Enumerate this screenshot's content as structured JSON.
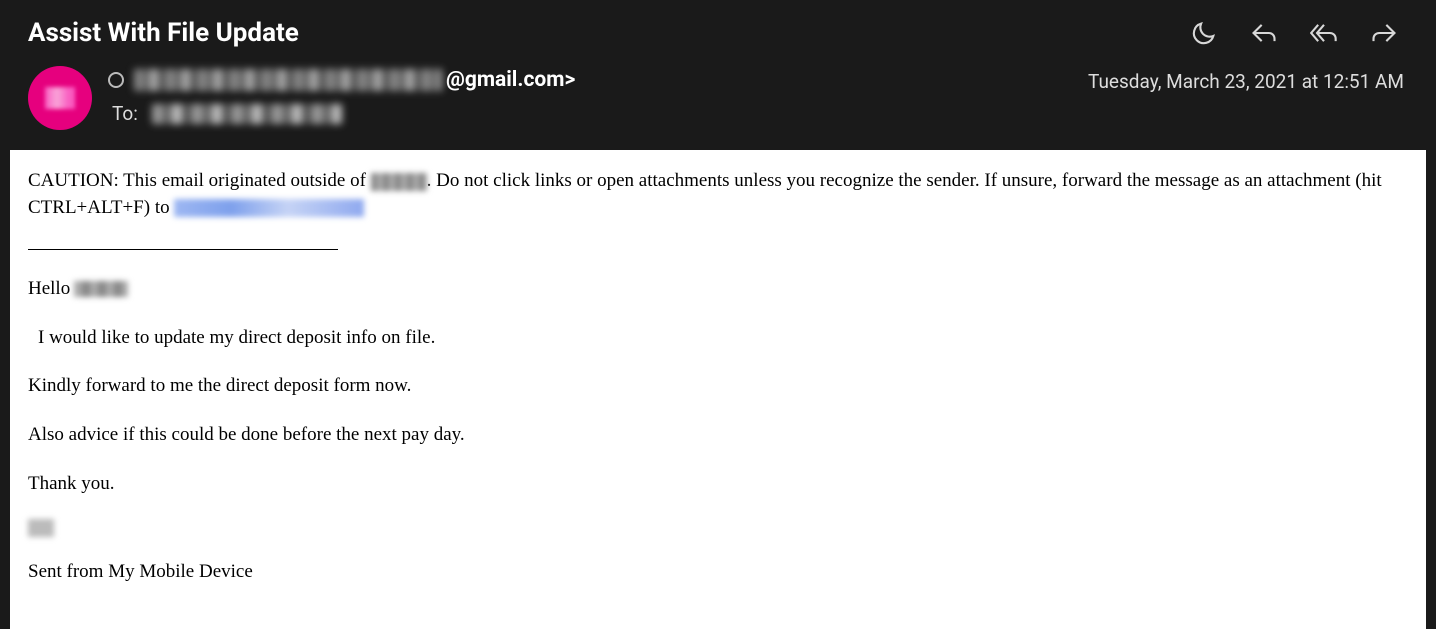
{
  "header": {
    "subject": "Assist With File Update",
    "sender_suffix": "@gmail.com>",
    "to_label": "To:",
    "timestamp": "Tuesday, March 23, 2021 at 12:51 AM"
  },
  "body": {
    "caution_pre": "CAUTION: This email originated outside of ",
    "caution_mid": ". Do not click links or open attachments unless you recognize the sender. If unsure, forward the message as an attachment (hit CTRL+ALT+F) to ",
    "hello": "Hello ",
    "line1": "I would like to update my direct deposit info on file.",
    "line2": "Kindly forward to me the direct deposit form now.",
    "line3": "Also advice if this could be done before the next pay day.",
    "line4": "Thank you.",
    "sent_from": "Sent from My Mobile Device"
  }
}
